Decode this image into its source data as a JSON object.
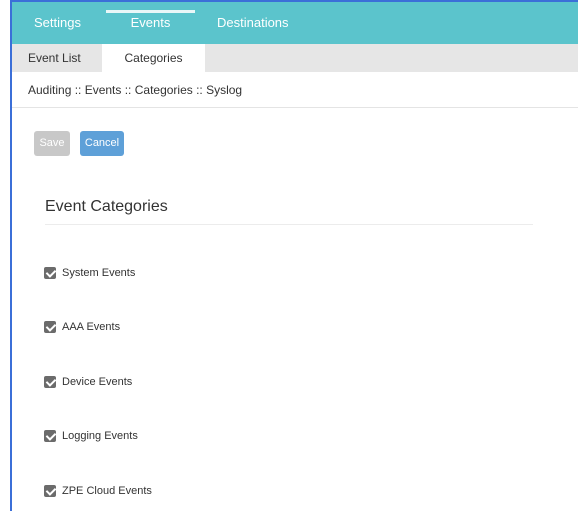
{
  "top_tabs": {
    "settings": "Settings",
    "events": "Events",
    "destinations": "Destinations"
  },
  "sub_tabs": {
    "event_list": "Event List",
    "categories": "Categories"
  },
  "breadcrumb": "Auditing :: Events :: Categories :: Syslog",
  "buttons": {
    "save": "Save",
    "cancel": "Cancel"
  },
  "section_title": "Event Categories",
  "categories": [
    {
      "label": "System Events",
      "checked": true
    },
    {
      "label": "AAA Events",
      "checked": true
    },
    {
      "label": "Device Events",
      "checked": true
    },
    {
      "label": "Logging Events",
      "checked": true
    },
    {
      "label": "ZPE Cloud Events",
      "checked": true
    }
  ],
  "colors": {
    "topnav_bg": "#5bc4cc",
    "subnav_bg": "#e6e6e6",
    "cancel_bg": "#5ea0d8",
    "save_disabled_bg": "#c8c8c8",
    "frame_accent": "#3b6fd8"
  }
}
